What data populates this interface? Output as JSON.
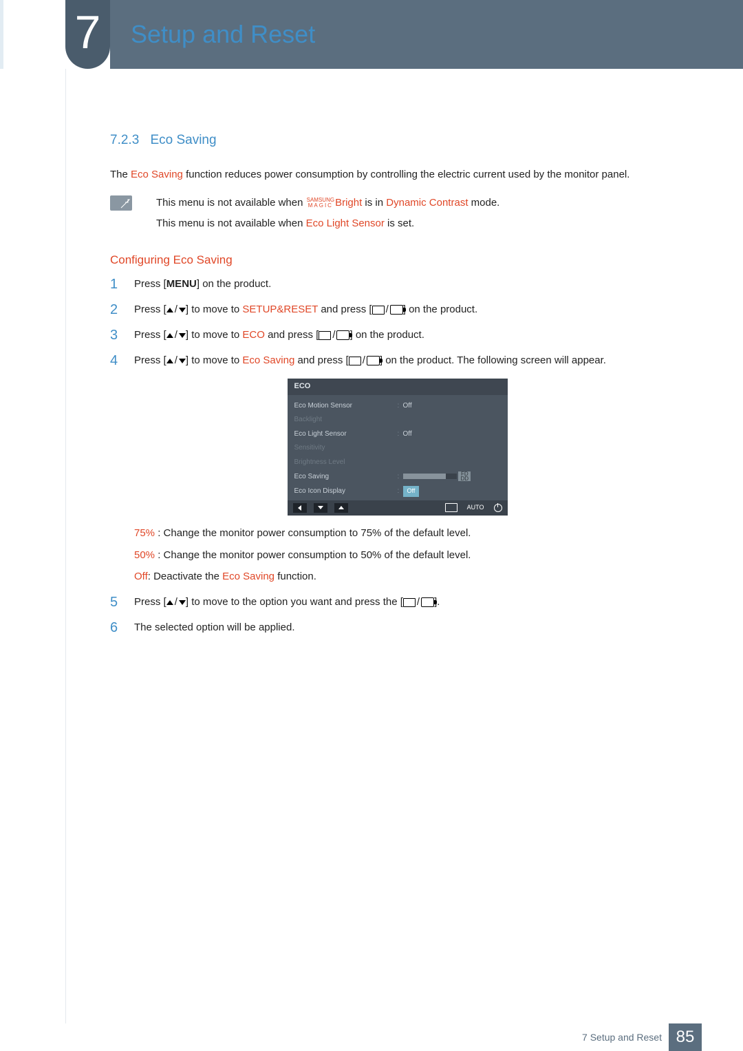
{
  "chapter_number": "7",
  "chapter_title": "Setup and Reset",
  "section_number": "7.2.3",
  "section_title": "Eco Saving",
  "intro": {
    "pre": "The ",
    "hl": "Eco Saving",
    "post": " function reduces power consumption by controlling the electric current used by the monitor panel."
  },
  "notes": {
    "n1_pre": "This menu is not available when ",
    "n1_stack_top": "SAMSUNG",
    "n1_stack_bot": "MAGIC",
    "n1_mid": "Bright",
    "n1_mid2": " is in ",
    "n1_hl": "Dynamic Contrast",
    "n1_post": " mode.",
    "n2_pre": "This menu is not available when ",
    "n2_hl": "Eco Light Sensor",
    "n2_post": " is set."
  },
  "sub_title": "Configuring Eco Saving",
  "steps": {
    "s1_a": "Press [",
    "s1_b": "MENU",
    "s1_c": "] on the product.",
    "s2_a": "Press [",
    "s2_b": "] to move to ",
    "s2_hl": "SETUP&RESET",
    "s2_c": " and press [",
    "s2_d": "] on the product.",
    "s3_a": "Press [",
    "s3_b": "] to move to ",
    "s3_hl": "ECO",
    "s3_c": " and press [",
    "s3_d": "] on the product.",
    "s4_a": "Press [",
    "s4_b": "] to move to ",
    "s4_hl": "Eco Saving",
    "s4_c": " and press [",
    "s4_d": "] on the product. The following screen will appear.",
    "s5_a": "Press [",
    "s5_b": "] to move to the option you want and press the [",
    "s5_c": "].",
    "s6": "The selected option will be applied."
  },
  "osd": {
    "title": "ECO",
    "rows": [
      {
        "label": "Eco Motion Sensor",
        "sep": ":",
        "value": "Off"
      },
      {
        "label": "Backlight",
        "sep": "",
        "value": ""
      },
      {
        "label": "Eco Light Sensor",
        "sep": ":",
        "value": "Off"
      },
      {
        "label": "Sensitivity",
        "sep": "",
        "value": ""
      },
      {
        "label": "Brightness Level",
        "sep": "",
        "value": ""
      },
      {
        "label": "Eco Saving",
        "sep": ":",
        "value": "bar",
        "bar_num_a": "FD",
        "bar_num_b": "DD"
      },
      {
        "label": "Eco Icon Display",
        "sep": ":",
        "value": "Off",
        "selected": true
      }
    ],
    "auto": "AUTO"
  },
  "options": {
    "o1_hl": "75%",
    "o1": " : Change the monitor power consumption to 75% of the default level.",
    "o2_hl": "50%",
    "o2": " : Change the monitor power consumption to 50% of the default level.",
    "o3_hl": "Off",
    "o3_a": ": Deactivate the ",
    "o3_hl2": "Eco Saving",
    "o3_b": " function."
  },
  "footer": {
    "text": "7 Setup and Reset",
    "page": "85"
  }
}
